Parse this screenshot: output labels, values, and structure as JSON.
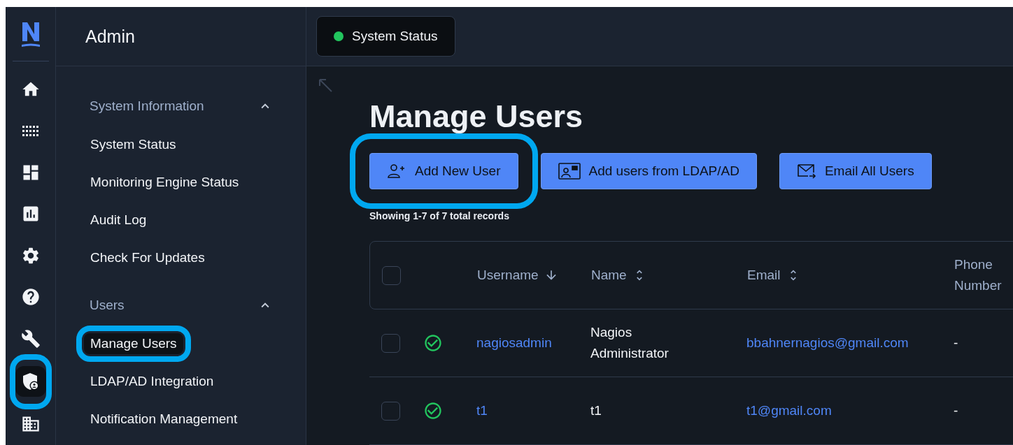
{
  "rail": {
    "items": [
      {
        "selected": false,
        "highlighted": false
      },
      {
        "selected": false,
        "highlighted": false
      },
      {
        "selected": false,
        "highlighted": false
      },
      {
        "selected": false,
        "highlighted": false
      },
      {
        "selected": false,
        "highlighted": false
      },
      {
        "selected": false,
        "highlighted": false
      },
      {
        "selected": false,
        "highlighted": false
      },
      {
        "selected": true,
        "highlighted": true
      },
      {
        "selected": false,
        "highlighted": false
      }
    ]
  },
  "sidebar": {
    "title": "Admin",
    "sections": [
      {
        "label": "System Information",
        "expanded": true,
        "items": [
          {
            "label": "System Status",
            "selected": false,
            "highlighted": false
          },
          {
            "label": "Monitoring Engine Status",
            "selected": false,
            "highlighted": false
          },
          {
            "label": "Audit Log",
            "selected": false,
            "highlighted": false
          },
          {
            "label": "Check For Updates",
            "selected": false,
            "highlighted": false
          }
        ]
      },
      {
        "label": "Users",
        "expanded": true,
        "items": [
          {
            "label": "Manage Users",
            "selected": true,
            "highlighted": true
          },
          {
            "label": "LDAP/AD Integration",
            "selected": false,
            "highlighted": false
          },
          {
            "label": "Notification Management",
            "selected": false,
            "highlighted": false
          }
        ]
      }
    ]
  },
  "header": {
    "status_tab": {
      "label": "System Status",
      "color": "#22c55e"
    }
  },
  "page": {
    "title": "Manage Users",
    "buttons": [
      {
        "label": "Add New User",
        "highlighted": true
      },
      {
        "label": "Add users from LDAP/AD",
        "highlighted": false
      },
      {
        "label": "Email All Users",
        "highlighted": false
      }
    ],
    "records": "Showing 1-7 of 7 total records"
  },
  "table": {
    "select_all": {
      "checked": false
    },
    "columns": [
      {
        "label": "Username",
        "kind": "sorted"
      },
      {
        "label": "Name",
        "kind": "sortable"
      },
      {
        "label": "Email",
        "kind": "sortable"
      },
      {
        "label": "Phone Number",
        "kind": "plain"
      }
    ],
    "rows": [
      {
        "checked": false,
        "active": true,
        "username": "nagiosadmin",
        "name": "Nagios Administrator",
        "email": "bbahnernagios@gmail.com",
        "phone": "-"
      },
      {
        "checked": false,
        "active": true,
        "username": "t1",
        "name": "t1",
        "email": "t1@gmail.com",
        "phone": "-"
      }
    ]
  }
}
